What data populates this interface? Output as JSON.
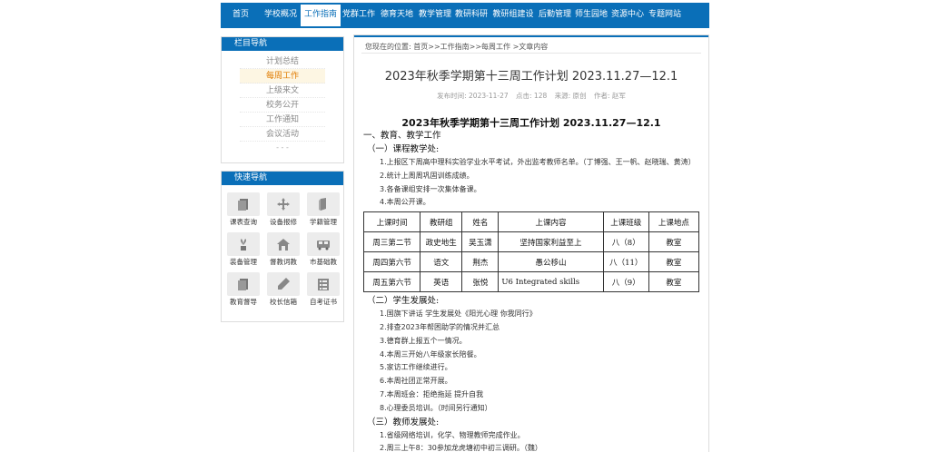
{
  "nav": {
    "items": [
      "首页",
      "学校概况",
      "工作指南",
      "党群工作",
      "德育天地",
      "教学管理",
      "教研科研",
      "教研组建设",
      "后勤管理",
      "师生园地",
      "资源中心",
      "专题网站"
    ],
    "active_index": 2
  },
  "sidebar": {
    "column_title": "栏目导航",
    "items": [
      "计划总结",
      "每周工作",
      "上级来文",
      "校务公开",
      "工作通知",
      "会议活动"
    ],
    "more": "- - -",
    "active_index": 1,
    "quick_title": "快速导航",
    "quick_items": [
      {
        "label": "课表查询",
        "icon": "document-stack-icon"
      },
      {
        "label": "设备报修",
        "icon": "cross-arrows-icon"
      },
      {
        "label": "学籍管理",
        "icon": "book-icon"
      },
      {
        "label": "装备管理",
        "icon": "plant-pot-icon"
      },
      {
        "label": "督教词教",
        "icon": "house-icon"
      },
      {
        "label": "市基础教",
        "icon": "bus-icon"
      },
      {
        "label": "教育督导",
        "icon": "document-stack-icon"
      },
      {
        "label": "校长信箱",
        "icon": "pencil-icon"
      },
      {
        "label": "自考证书",
        "icon": "checklist-icon"
      }
    ]
  },
  "breadcrumb": "您现在的位置: 首页>>工作指南>>每周工作 >文章内容",
  "article": {
    "title": "2023年秋季学期第十三周工作计划 2023.11.27—12.1",
    "meta": {
      "time": "发布时间: 2023-11-27",
      "clicks": "点击: 128",
      "source": "来源: 原创",
      "author": "作者: 赵军"
    },
    "heading": "2023年秋季学期第十三周工作计划 2023.11.27—12.1",
    "section1": "一、教育、教学工作",
    "sub1": "（一）课程教学处:",
    "sub1_lines": [
      "1.上报区下周高中理科实验学业水平考试，外出监考教师名单。（丁博强、王一帆、赵晓瑞、黄涛）",
      "2.统计上周周巩固训练成绩。",
      "3.各备课组安排一次集体备课。",
      "4.本周公开课。"
    ],
    "table": {
      "headers": [
        "上课时间",
        "教研组",
        "姓名",
        "上课内容",
        "上课班级",
        "上课地点"
      ],
      "rows": [
        [
          "周三第二节",
          "政史地生",
          "吴玉潇",
          "坚持国家利益至上",
          "八（8）",
          "教室"
        ],
        [
          "周四第六节",
          "语文",
          "荆杰",
          "愚公移山",
          "八（11）",
          "教室"
        ],
        [
          "周五第六节",
          "英语",
          "张悦",
          "U6  Integrated  skills",
          "八（9）",
          "教室"
        ]
      ]
    },
    "sub2": "（二）学生发展处:",
    "sub2_lines": [
      "1.国旗下讲话        学生发展处《阳光心理 你我同行》",
      "2.排查2023年帮困助学的情况并汇总",
      "3.德育群上报五个一情况。",
      "4.本周三开始八年级家长陪餐。",
      "5.家访工作继续进行。",
      "6.本周社团正常开展。",
      "7.本周班会：拒绝拖延 提升自我",
      "8.心理委员培训。（时间另行通知）"
    ],
    "sub3": "（三）教师发展处:",
    "sub3_lines": [
      "1.省级网络培训，化学、物理教师完成作业。",
      "2.周三上午8：30参加龙虎塘初中初三调研。（魏）"
    ]
  },
  "colors": {
    "brand": "#0a6fb8",
    "active_side": "#e07b00"
  }
}
